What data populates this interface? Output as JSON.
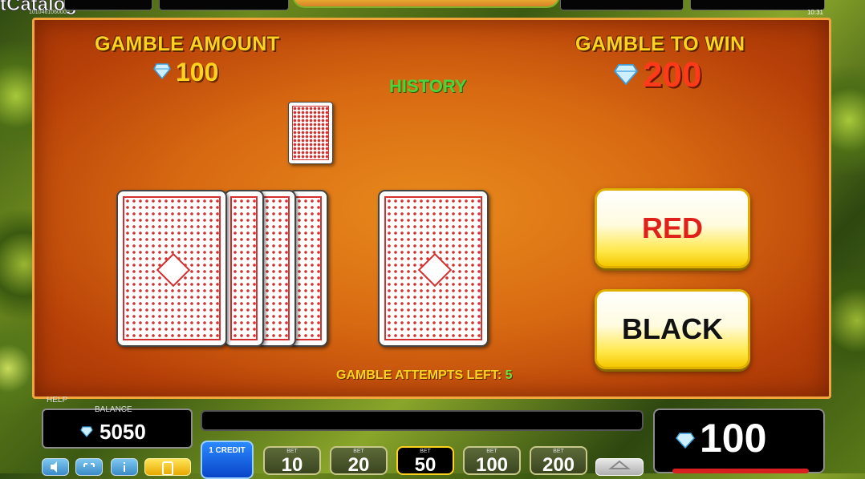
{
  "branding": {
    "logo_text": "tCatalog",
    "logo_sub": "1010461060000"
  },
  "clock": "10:31",
  "gamble": {
    "amount_label": "GAMBLE AMOUNT",
    "amount_value": "100",
    "win_label": "GAMBLE TO WIN",
    "win_value": "200",
    "history_label": "HISTORY",
    "attempts_label": "GAMBLE ATTEMPTS LEFT:",
    "attempts_value": "5",
    "red_button": "RED",
    "black_button": "BLACK"
  },
  "footer": {
    "help_label": "HELP",
    "balance_label": "BALANCE",
    "balance_value": "5050",
    "win_display": "100",
    "credit_label": "1 CREDIT",
    "bet_label": "BET",
    "bets": [
      "10",
      "20",
      "50",
      "100",
      "200"
    ],
    "active_bet": "50"
  },
  "colors": {
    "accent_yellow": "#ffd21e",
    "win_red": "#ff3a1a",
    "history_green": "#4cd43a",
    "panel_orange": "#d86a12"
  }
}
